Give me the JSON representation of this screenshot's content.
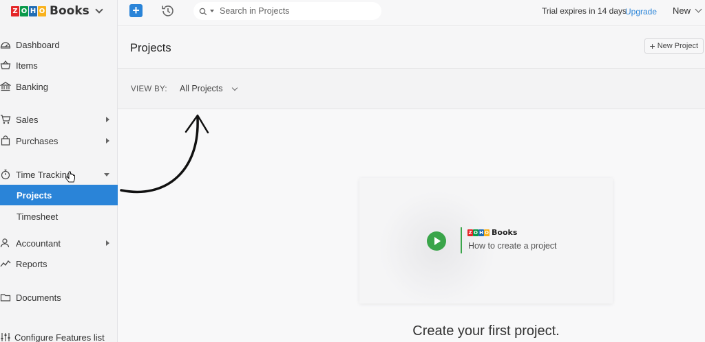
{
  "brand": {
    "logo_letters": [
      "Z",
      "O",
      "H",
      "O"
    ],
    "logo_colors": [
      "#e42527",
      "#089949",
      "#226db4",
      "#f9b21d"
    ],
    "name": "Books"
  },
  "sidebar": {
    "items": [
      {
        "label": "Dashboard",
        "icon": "dashboard-icon"
      },
      {
        "label": "Items",
        "icon": "basket-icon"
      },
      {
        "label": "Banking",
        "icon": "bank-icon"
      },
      {
        "label": "Sales",
        "icon": "cart-icon"
      },
      {
        "label": "Purchases",
        "icon": "bag-icon"
      },
      {
        "label": "Time Tracking",
        "icon": "stopwatch-icon"
      },
      {
        "label": "Accountant",
        "icon": "user-icon"
      },
      {
        "label": "Reports",
        "icon": "chart-line-icon"
      },
      {
        "label": "Documents",
        "icon": "folder-icon"
      },
      {
        "label": "Configure Features list",
        "icon": "sliders-icon"
      }
    ],
    "sub_items": [
      "Projects",
      "Timesheet"
    ],
    "active_color": "#2a84d8"
  },
  "topbar": {
    "search_placeholder": "Search in Projects",
    "trial_text": "Trial expires in 14 days",
    "upgrade_label": "Upgrade",
    "new_label": "New"
  },
  "header": {
    "title": "Projects",
    "new_project_label": "New Project"
  },
  "filter": {
    "view_by_label": "VIEW BY:",
    "view_value": "All Projects"
  },
  "video": {
    "brand_letters": [
      "Z",
      "O",
      "H",
      "O"
    ],
    "brand_name": "Books",
    "title": "How to create a project"
  },
  "cta": "Create your first project."
}
